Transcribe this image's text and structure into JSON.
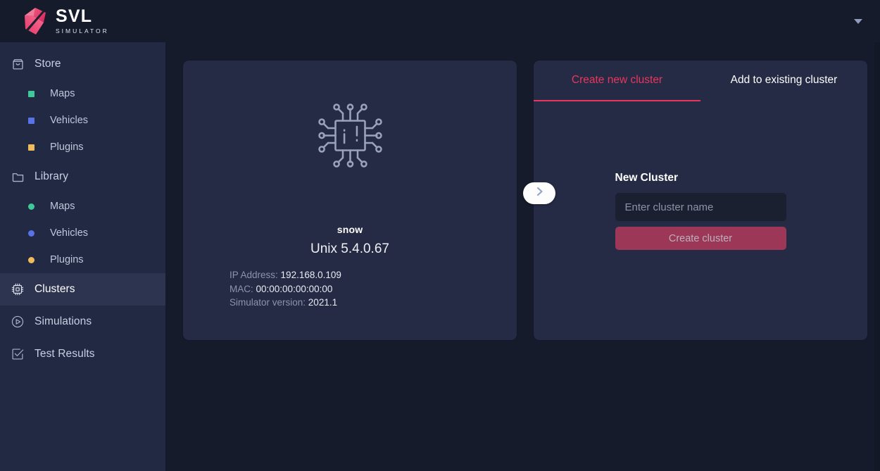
{
  "header": {
    "brand_title": "SVL",
    "brand_subtitle": "SIMULATOR",
    "logo_icon": "svl-logo-icon",
    "caret_icon": "chevron-down-icon"
  },
  "sidebar": {
    "groups": [
      {
        "label": "Store",
        "icon": "store-bag-icon",
        "active": false,
        "children": [
          {
            "label": "Maps",
            "marker": "square",
            "color": "#3fc99a"
          },
          {
            "label": "Vehicles",
            "marker": "square",
            "color": "#5a72e8"
          },
          {
            "label": "Plugins",
            "marker": "square",
            "color": "#f0bb5a"
          }
        ]
      },
      {
        "label": "Library",
        "icon": "folder-icon",
        "active": false,
        "children": [
          {
            "label": "Maps",
            "marker": "circle",
            "color": "#3fc99a"
          },
          {
            "label": "Vehicles",
            "marker": "circle",
            "color": "#5a72e8"
          },
          {
            "label": "Plugins",
            "marker": "circle",
            "color": "#f0bb5a"
          }
        ]
      }
    ],
    "items": [
      {
        "label": "Clusters",
        "icon": "chip-icon",
        "active": true
      },
      {
        "label": "Simulations",
        "icon": "play-circle-icon",
        "active": false
      },
      {
        "label": "Test Results",
        "icon": "checkbox-check-icon",
        "active": false
      }
    ]
  },
  "node_card": {
    "icon": "chip-circuit-icon",
    "name": "snow",
    "os": "Unix 5.4.0.67",
    "meta": [
      {
        "label": "IP Address:",
        "value": "192.168.0.109"
      },
      {
        "label": "MAC:",
        "value": "00:00:00:00:00:00"
      },
      {
        "label": "Simulator version:",
        "value": "2021.1"
      }
    ]
  },
  "transfer": {
    "arrow_icon": "chevron-right-icon"
  },
  "cluster_panel": {
    "tabs": [
      {
        "label": "Create new cluster",
        "active": true
      },
      {
        "label": "Add to existing cluster",
        "active": false
      }
    ],
    "form_title": "New Cluster",
    "input_value": "",
    "input_placeholder": "Enter cluster name",
    "create_button": "Create cluster"
  },
  "colors": {
    "accent": "#e8365e",
    "sidebar_bg": "#222942",
    "main_bg": "#161b2b",
    "card_bg": "#252b45",
    "active_nav_bg": "#2d3450",
    "button_bg": "#9d3758"
  }
}
